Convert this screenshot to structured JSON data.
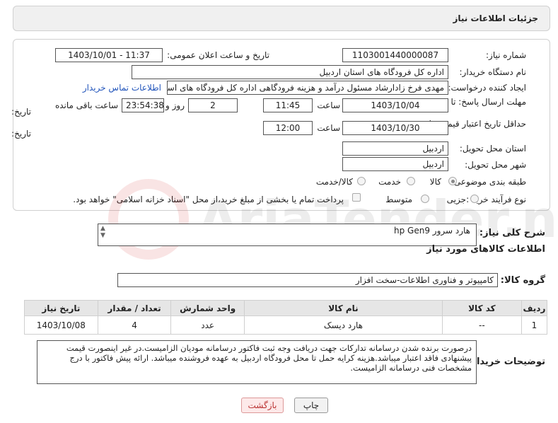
{
  "page_title": "جزئیات اطلاعات نیاز",
  "fields": {
    "need_number_label": "شماره نیاز:",
    "need_number": "1103001440000087",
    "announce_label": "تاریخ و ساعت اعلان عمومی:",
    "announce_value": "1403/10/01 - 11:37",
    "buyer_org_label": "نام دستگاه خریدار:",
    "buyer_org": "اداره کل فرودگاه های استان اردبیل",
    "creator_label": "ایجاد کننده درخواست:",
    "creator": "مهدی فرخ زادارشاد مسئول درآمد و هزینه فرودگاهی اداره کل فرودگاه های استان",
    "contact_link": "اطلاعات تماس خریدار",
    "deadline_label": "مهلت ارسال پاسخ: تا",
    "deadline_label2": "تاریخ:",
    "deadline_date": "1403/10/04",
    "time_label": "ساعت",
    "deadline_time": "11:45",
    "days_value": "2",
    "days_label": "روز و",
    "remaining_value": "23:54:38",
    "remaining_label": "ساعت باقی مانده",
    "validity_label": "حداقل تاریخ اعتبار قیمت: تا",
    "validity_label2": "تاریخ:",
    "validity_date": "1403/10/30",
    "validity_time": "12:00",
    "province_label": "استان محل تحویل:",
    "province": "اردبیل",
    "city_label": "شهر محل تحویل:",
    "city": "اردبیل",
    "category_label": "طبقه بندی موضوعی:",
    "category_options": [
      "کالا",
      "خدمت",
      "کالا/خدمت"
    ],
    "process_label": "نوع فرآیند خرید :",
    "process_options": [
      "جزیی",
      "متوسط"
    ],
    "process_note": "پرداخت تمام یا بخشی از مبلغ خرید،از محل \"اسناد خزانه اسلامی\" خواهد بود."
  },
  "summary": {
    "label": "شرح کلی نیاز:",
    "value": "هارد سرور hp Gen9"
  },
  "goods_info_title": "اطلاعات کالاهای مورد نیاز",
  "goods_group": {
    "label": "گروه کالا:",
    "value": "کامپیوتر و فناوری اطلاعات-سخت افزار"
  },
  "table": {
    "headers": [
      "ردیف",
      "کد کالا",
      "نام کالا",
      "واحد شمارش",
      "تعداد / مقدار",
      "تاریخ نیاز"
    ],
    "rows": [
      [
        "1",
        "--",
        "هارد دیسک",
        "عدد",
        "4",
        "1403/10/08"
      ]
    ]
  },
  "buyer_notes": {
    "label": "توضیحات خریدار:",
    "value": "درصورت برنده شدن درسامانه تدارکات جهت دریافت وجه ثبت فاکتور درسامانه مودیان الزامیست.در غیر اینصورت قیمت پیشنهادی فاقد اعتبار میباشد.هزینه کرایه حمل تا محل فرودگاه اردبیل به عهده فروشنده میباشد. ارائه پیش فاکتور با درج مشخصات فنی درسامانه الزامیست."
  },
  "buttons": {
    "print": "چاپ",
    "back": "بازگشت"
  },
  "watermark": "AriaTender.net"
}
